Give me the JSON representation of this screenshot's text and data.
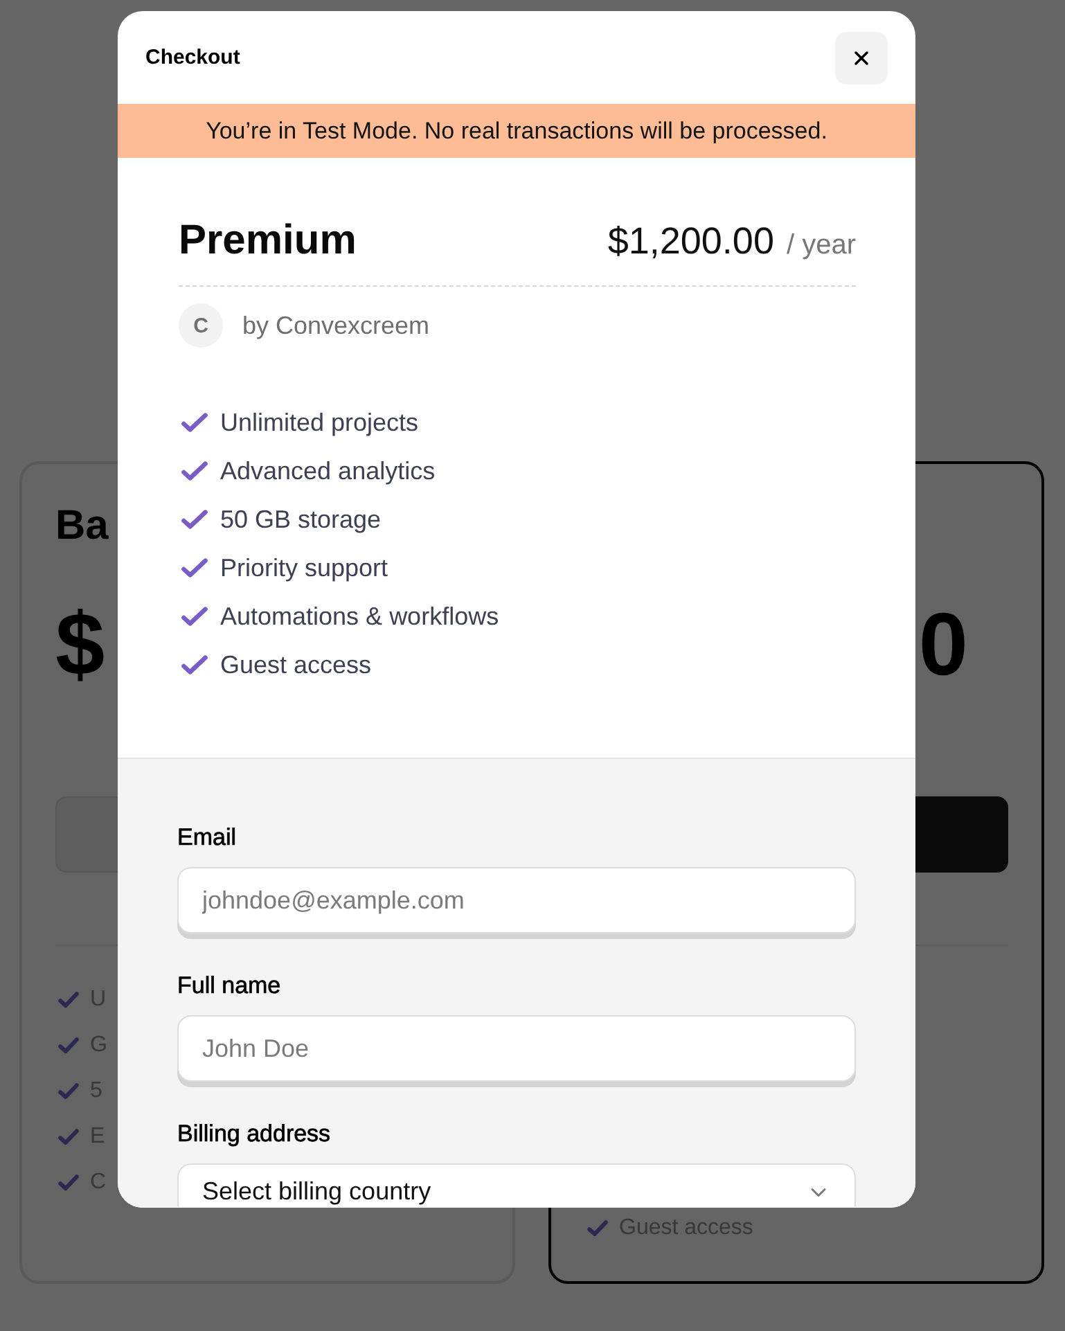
{
  "background": {
    "plans": [
      {
        "featured": false,
        "title": "Ba",
        "price": "$",
        "features": [
          "U",
          "G",
          "5",
          "E",
          "C"
        ]
      },
      {
        "featured": true,
        "price": "0",
        "features": [
          "Guest access"
        ]
      }
    ]
  },
  "checkout": {
    "title": "Checkout",
    "notice": "You’re in Test Mode. No real transactions will be processed.",
    "product": {
      "name": "Premium",
      "price": "$1,200.00",
      "period": "/ year",
      "seller_initial": "C",
      "seller": "by Convexcreem",
      "features": [
        "Unlimited projects",
        "Advanced analytics",
        "50 GB storage",
        "Priority support",
        "Automations & workflows",
        "Guest access"
      ]
    },
    "fields": [
      {
        "kind": "input",
        "label": "Email",
        "placeholder": "johndoe@example.com"
      },
      {
        "kind": "input",
        "label": "Full name",
        "placeholder": "John Doe"
      },
      {
        "kind": "select",
        "label": "Billing address",
        "value": "Select billing country"
      }
    ]
  }
}
